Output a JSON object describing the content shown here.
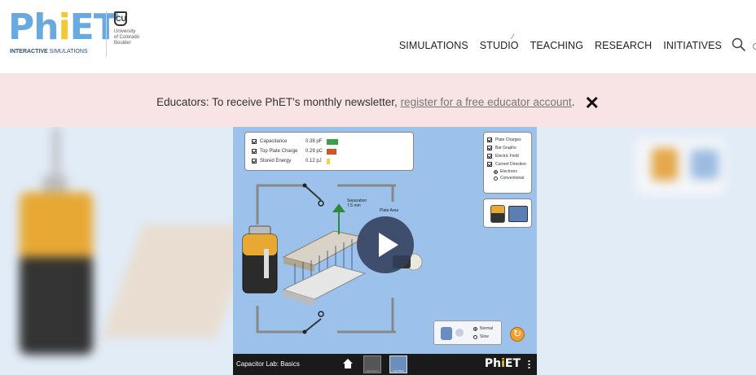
{
  "brand": {
    "logo_ph": "Ph",
    "logo_i": "i",
    "logo_et": "ET",
    "logo_sub_bold": "INTERACTIVE",
    "logo_sub_rest": " SIMULATIONS",
    "university_lines": [
      "University",
      "of Colorado",
      "Boulder"
    ],
    "colors": {
      "blue": "#6aa9e0",
      "yellow": "#f4c82e"
    }
  },
  "nav": {
    "items": [
      "SIMULATIONS",
      "STUDIO",
      "TEACHING",
      "RESEARCH",
      "INITIATIVES"
    ],
    "search_icon": "search-icon"
  },
  "banner": {
    "lead": "Educators: To receive PhET's monthly newsletter, ",
    "link": "register for a free educator account",
    "tail": ".",
    "close": "✕"
  },
  "sim": {
    "title": "Capacitor Lab: Basics",
    "tabs": [
      "Capacitance",
      "Light Bulb"
    ],
    "logo_ph": "Ph",
    "logo_i": "i",
    "logo_et": "ET",
    "meters": [
      {
        "label": "Capacitance",
        "value": "0.38 pF",
        "color": "#3aa04a"
      },
      {
        "label": "Top Plate Charge",
        "value": "0.29 pC",
        "color": "#d0562a"
      },
      {
        "label": "Stored Energy",
        "value": "0.12 pJ",
        "color": "#e8d84a"
      }
    ],
    "options": [
      "Plate Charges",
      "Bar Graphs",
      "Electric Field",
      "Current Direction"
    ],
    "current_modes": [
      "Electrons",
      "Conventional"
    ],
    "speeds": [
      "Normal",
      "Slow"
    ],
    "separation_label": "Separation",
    "separation_value": "7.5 mm",
    "plate_area_label": "Plate Area"
  }
}
